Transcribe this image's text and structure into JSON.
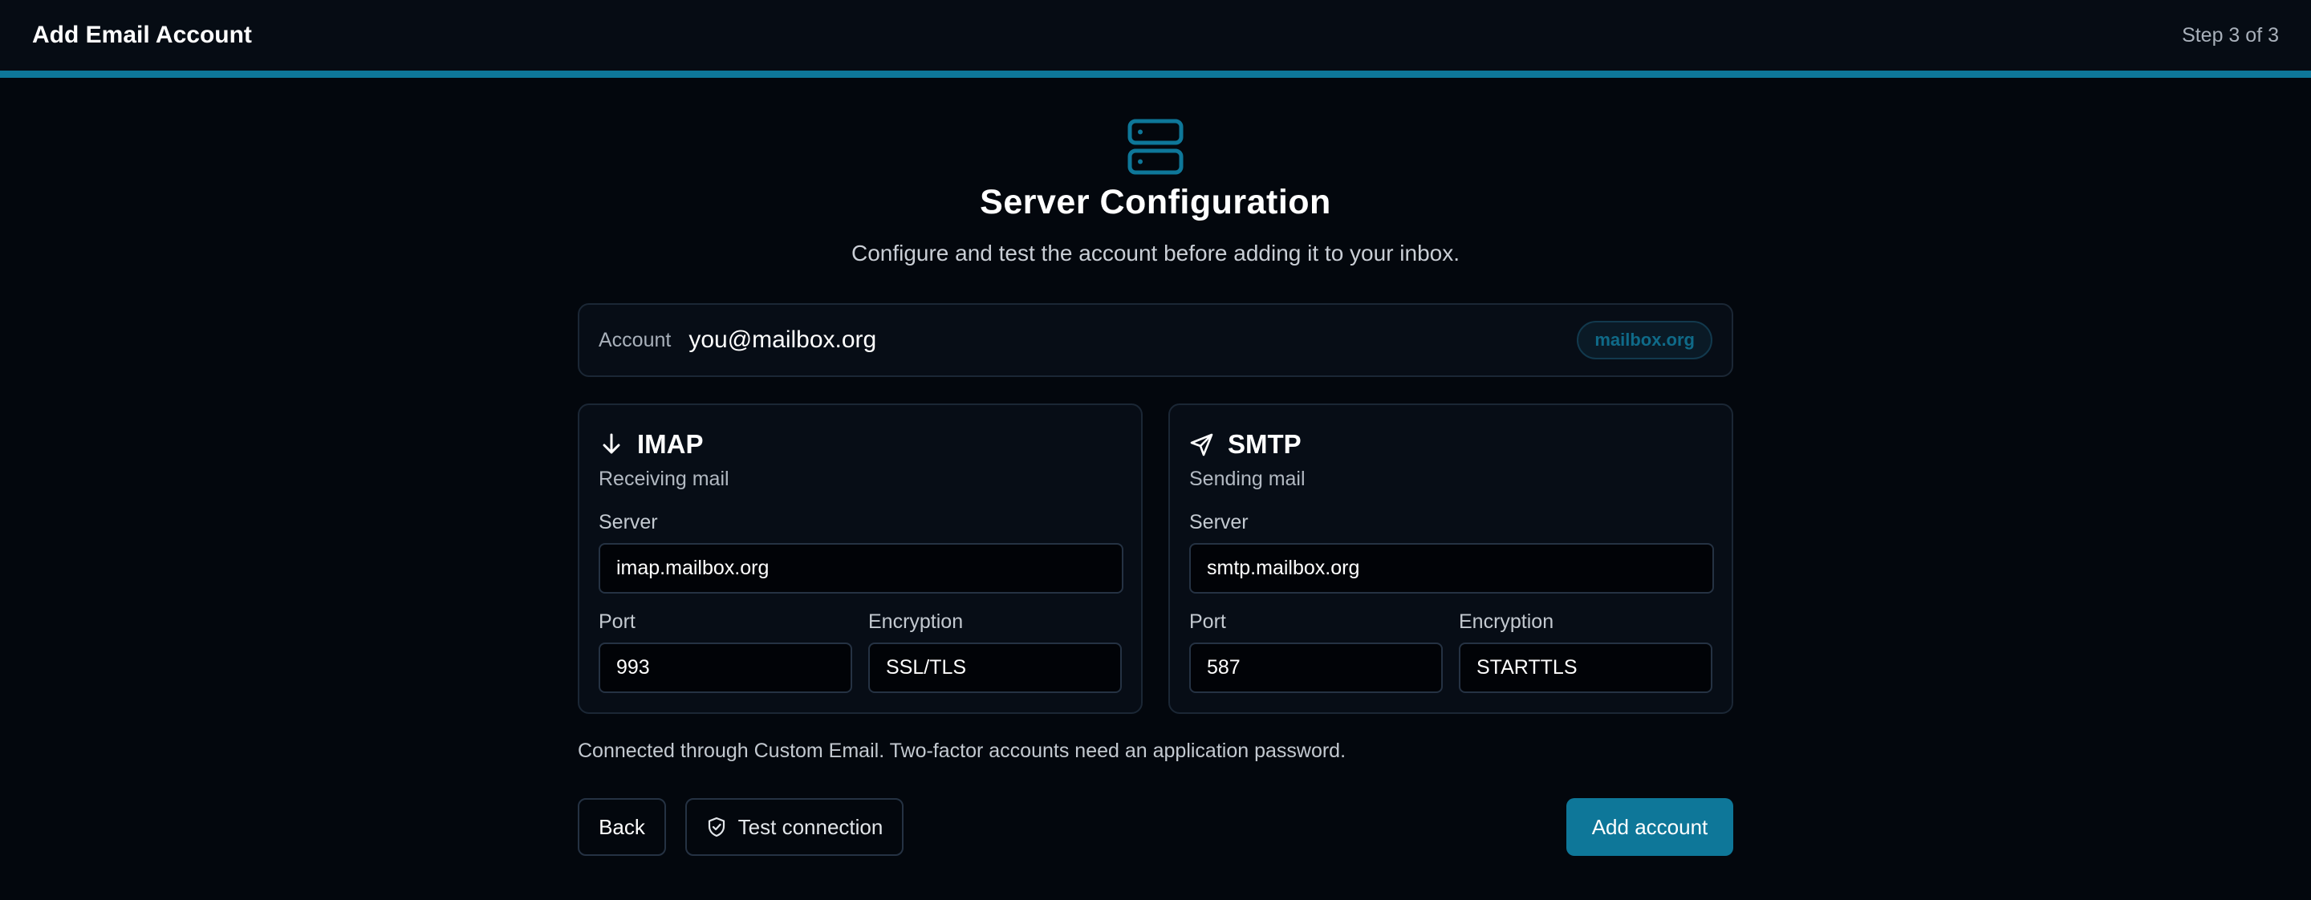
{
  "header": {
    "title": "Add Email Account",
    "step": "Step 3 of 3",
    "progress": 1.0
  },
  "hero": {
    "icon": "server-icon",
    "title": "Server Configuration",
    "subtitle": "Configure and test the account before adding it to your inbox."
  },
  "account": {
    "label": "Account",
    "email": "you@mailbox.org",
    "domain_badge": "mailbox.org"
  },
  "imap": {
    "icon": "arrow-down-icon",
    "title": "IMAP",
    "description": "Receiving mail",
    "server_label": "Server",
    "server_value": "imap.mailbox.org",
    "port_label": "Port",
    "port_value": "993",
    "encryption_label": "Encryption",
    "encryption_value": "SSL/TLS"
  },
  "smtp": {
    "icon": "send-icon",
    "title": "SMTP",
    "description": "Sending mail",
    "server_label": "Server",
    "server_value": "smtp.mailbox.org",
    "port_label": "Port",
    "port_value": "587",
    "encryption_label": "Encryption",
    "encryption_value": "STARTTLS"
  },
  "note": "Connected through Custom Email. Two-factor accounts need an application password.",
  "actions": {
    "back_label": "Back",
    "test_label": "Test connection",
    "test_icon": "shield-check-icon",
    "add_label": "Add account"
  },
  "colors": {
    "accent": "#0e7799",
    "background": "#03070d",
    "card_border": "#1b2735"
  }
}
